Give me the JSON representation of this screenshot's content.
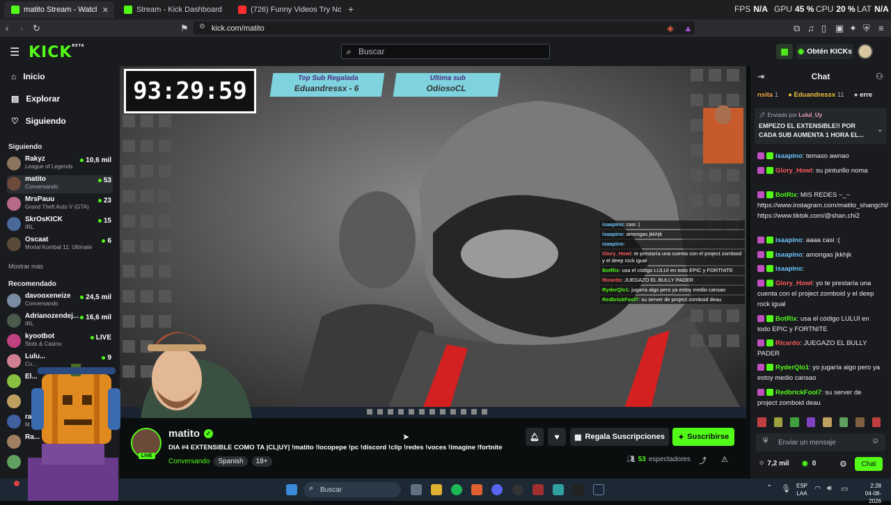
{
  "browser": {
    "tabs": [
      {
        "title": "matito Stream - Watch Live o",
        "active": true
      },
      {
        "title": "Stream - Kick Dashboard",
        "active": false
      },
      {
        "title": "(726) Funny Videos Try Not to Laugh",
        "active": false
      }
    ],
    "new_tab": "+",
    "hud": {
      "fps_label": "FPS",
      "fps": "N/A",
      "gpu_label": "GPU",
      "gpu": "45 %",
      "cpu_label": "CPU",
      "cpu": "20 %",
      "lat_label": "LAT",
      "lat": "N/A"
    },
    "url": "kick.com/matito"
  },
  "header": {
    "logo": "KICK",
    "logo_beta": "BETA",
    "search_placeholder": "Buscar",
    "get_kicks": "Obtén KICKs"
  },
  "sidebar": {
    "nav": [
      {
        "label": "Inicio",
        "icon": "home-icon"
      },
      {
        "label": "Explorar",
        "icon": "compass-icon"
      },
      {
        "label": "Siguiendo",
        "icon": "heart-icon"
      }
    ],
    "following_title": "Siguiendo",
    "following": [
      {
        "name": "Rakyz",
        "game": "League of Legends",
        "viewers": "10,6 mil",
        "color": "#8a7560"
      },
      {
        "name": "matito",
        "game": "Conversando",
        "viewers": "53",
        "color": "#6b4a3a"
      },
      {
        "name": "MrsPauu",
        "game": "Grand Theft Auto V (GTA)",
        "viewers": "23",
        "color": "#b86a8a"
      },
      {
        "name": "SkrOsKICK",
        "game": "IRL",
        "viewers": "15",
        "color": "#4a6a9a"
      },
      {
        "name": "Oscaat",
        "game": "Mortal Kombat 11: Ultimate",
        "viewers": "6",
        "color": "#5a4a3a"
      }
    ],
    "show_more": "Mostrar más",
    "recommended_title": "Recomendado",
    "recommended": [
      {
        "name": "davooxeneize",
        "game": "Conversando",
        "viewers": "24,5 mil",
        "color": "#7a8aa0"
      },
      {
        "name": "Adrianozendej...",
        "game": "IRL",
        "viewers": "16,6 mil",
        "color": "#4a5a4a"
      },
      {
        "name": "kyootbot",
        "game": "Slots & Casino",
        "viewers": "LIVE",
        "color": "#c04080"
      },
      {
        "name": "Lulu...",
        "game": "Co...",
        "viewers": "9",
        "color": "#d08090"
      },
      {
        "name": "El...",
        "game": "",
        "viewers": "",
        "color": "#8ac040"
      },
      {
        "name": "",
        "game": "",
        "viewers": "",
        "color": "#c0a060"
      },
      {
        "name": "rag...",
        "game": "M...",
        "viewers": "63",
        "color": "#4060a0"
      },
      {
        "name": "Ra...",
        "game": "",
        "viewers": "",
        "color": "#a08060"
      },
      {
        "name": "",
        "game": "",
        "viewers": "",
        "color": "#60a060"
      }
    ]
  },
  "video": {
    "timer": "93:29:59",
    "top_sub_label": "Top Sub Regalada",
    "top_sub_name": "Eduandressx - 6",
    "last_sub_label": "Ultima sub",
    "last_sub_name": "OdiosoCL",
    "overlay_chat": [
      {
        "user": "isaapino",
        "text": "casi :(",
        "color": "#6ec6ff"
      },
      {
        "user": "isaapino",
        "text": "amongas jkkhjk",
        "color": "#6ec6ff"
      },
      {
        "user": "isaapino",
        "text": "",
        "color": "#6ec6ff"
      },
      {
        "user": "Glory_Howl",
        "text": "te prestaría una cuenta con el project zomboid y el deep rock igual",
        "color": "#ff5a5a"
      },
      {
        "user": "BotRix",
        "text": "usa el código LULUI en todo EPIC y FORTNITE",
        "color": "#53fc18"
      },
      {
        "user": "Ricardo",
        "text": "JUEGAZO EL BULLY PADER",
        "color": "#ff5a5a"
      },
      {
        "user": "RyderQlo1",
        "text": "jugaría algo pero ya estoy medio cansao",
        "color": "#53fc18"
      },
      {
        "user": "RedbrickFool7",
        "text": "su server de project zomboid deau",
        "color": "#53fc18"
      }
    ]
  },
  "info": {
    "streamer": "matito",
    "live_badge": "LIVE",
    "title": "DIA #4 EXTENSIBLE COMO TA |CL|UY| !matito !locopepe !pc !discord !clip !redes !voces !imagine !fortnite",
    "category": "Conversando",
    "tags": [
      "Spanish",
      "18+"
    ],
    "gift_label": "Regala Suscripciones",
    "subscribe_label": "Suscribirse",
    "viewers_count": "53",
    "viewers_label": "espectadores"
  },
  "chat": {
    "title": "Chat",
    "gifters": [
      {
        "name": "nsita",
        "count": "1"
      },
      {
        "name": "Eduandressx",
        "count": "11"
      },
      {
        "name": "erre",
        "count": ""
      }
    ],
    "pinned_by_label": "Enviado por",
    "pinned_by": "Lulul_Uy",
    "pinned_text": "EMPEZO EL EXTENSIBLE!! POR CADA SUB AUMENTA 1 HORA EL...",
    "messages": [
      {
        "user": "isaapino",
        "text": "temaso awnao",
        "color": "#6ec6ff"
      },
      {
        "user": "Glory_Howl",
        "text": "su pinturillo noma",
        "color": "#ff5a5a"
      },
      {
        "user": "BotRix",
        "text": "MIS REDES ~_~ https://www.instagram.com/matito_shangchi/ https://www.tiktok.com/@shan.chi2",
        "color": "#53fc18"
      },
      {
        "user": "isaapino",
        "text": "aaaa casi :(",
        "color": "#6ec6ff"
      },
      {
        "user": "isaapino",
        "text": "amongas jkkhjk",
        "color": "#6ec6ff"
      },
      {
        "user": "isaapino",
        "text": "",
        "color": "#6ec6ff"
      },
      {
        "user": "Glory_Howl",
        "text": "yo te prestaría una cuenta con el project zomboid y el deep rock igual",
        "color": "#ff5a5a"
      },
      {
        "user": "BotRix",
        "text": "usa el código LULUI en todo EPIC y FORTNITE",
        "color": "#53fc18"
      },
      {
        "user": "Ricardo",
        "text": "JUEGAZO EL BULLY PADER",
        "color": "#ff5a5a"
      },
      {
        "user": "RyderQlo1",
        "text": "yo jugaría algo pero ya estoy medio cansao",
        "color": "#53fc18"
      },
      {
        "user": "RedbrickFool7",
        "text": "su server de project zomboid deau",
        "color": "#53fc18"
      }
    ],
    "input_placeholder": "Enviar un mensaje",
    "kicks_count": "7,2 mil",
    "points": "0",
    "send_label": "Chat"
  },
  "taskbar": {
    "search_placeholder": "Buscar",
    "lang": "ESP",
    "lang_sub": "LAA",
    "time": "2:28",
    "date": "04-08-2026"
  },
  "colors": {
    "accent": "#53fc18",
    "bg": "#0b0e0f",
    "panel": "#191b1f"
  }
}
